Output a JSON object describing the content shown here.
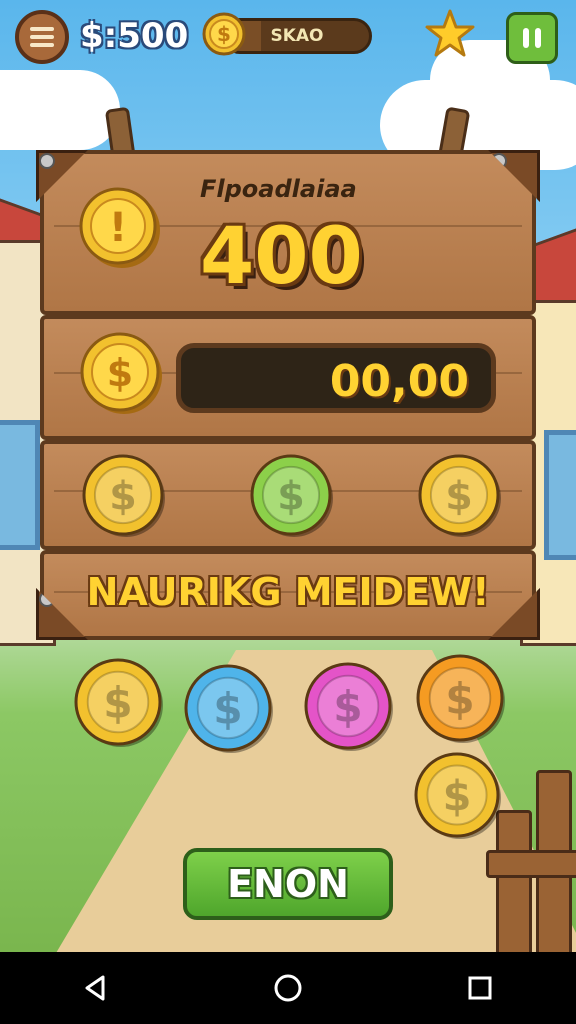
{
  "hud": {
    "money": "$:500",
    "xp_label": "SKAO",
    "xp_progress": 0.25,
    "menu_icon": "menu-icon",
    "star_icon": "star-icon",
    "pause_icon": "pause-icon"
  },
  "board": {
    "bonus_label": "Flpoadlaiaa",
    "bonus_value": "400",
    "counter_value": "00,00",
    "banner": "NAURIKG MEIDEW!"
  },
  "coins": {
    "board_row": [
      "gold",
      "green",
      "gold"
    ],
    "ground_row": [
      "gold",
      "blue",
      "pink",
      "orange"
    ],
    "extra": [
      "gold"
    ]
  },
  "cta_label": "ENON",
  "colors": {
    "gold": "#f2c12e",
    "green": "#8cd04a",
    "blue": "#4fb4ea",
    "pink": "#e454c8",
    "orange": "#f59b22",
    "wood": "#c38b5c"
  },
  "navbar": {
    "back_icon": "back-icon",
    "home_icon": "home-icon",
    "recents_icon": "recents-icon"
  }
}
